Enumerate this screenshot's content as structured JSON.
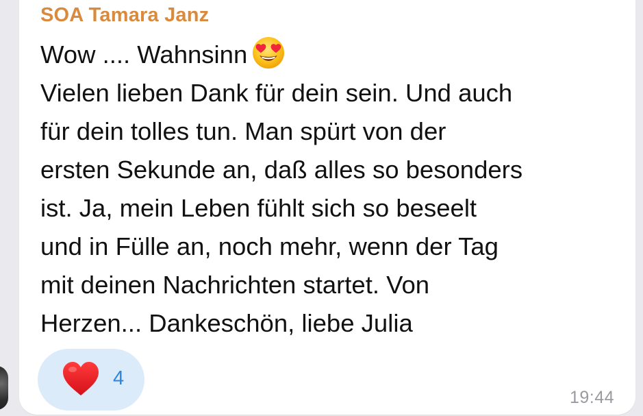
{
  "message": {
    "sender_name": "SOA Tamara Janz",
    "lines": [
      "Wow .... Wahnsinn",
      "Vielen lieben Dank für dein sein. Und auch",
      "für dein tolles tun. Man spürt von der",
      "ersten Sekunde an, daß alles so besonders",
      "ist. Ja, mein Leben fühlt sich so beseelt",
      "und in Fülle an, noch mehr, wenn der Tag",
      "mit deinen Nachrichten startet. Von",
      "Herzen... Dankeschön, liebe Julia"
    ],
    "first_line_emoji": "smiling-face-with-heart-eyes-icon",
    "reaction": {
      "icon": "red-heart-icon",
      "count": "4"
    },
    "time": "19:44"
  },
  "colors": {
    "sender": "#d98a3d",
    "reaction_bg": "#dcebfa",
    "reaction_count": "#2b86e0",
    "timestamp": "#9a9aa0",
    "heart": "#e0161e"
  }
}
